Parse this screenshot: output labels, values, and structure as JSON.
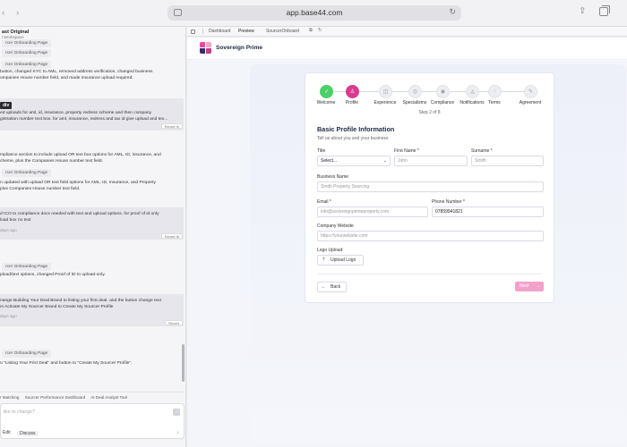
{
  "browser": {
    "url": "app.base44.com",
    "back_glyph": "‹",
    "forward_glyph": "›",
    "reload_glyph": "↻",
    "share_glyph": "⇪"
  },
  "chat": {
    "project_title": "ast Original",
    "project_subtitle": "l Workspace",
    "tags": [
      "rcer Onboarding Page",
      "rcer Onboarding Page",
      "rcer Onboarding Page",
      "rcer Onboarding Page",
      "rcer Onboarding Page"
    ],
    "dark_tag": "div",
    "messages": [
      "button, changed KYC to AML, removed address verification, changed business\nompanies House number field, and made insurance upload required.",
      "ed uploads for aml, id, insurance, property redress scheme and then company\ngistration number text box. for aml, insurance, redress and tax id give upload and tex...",
      "mpliance section to include upload OR text box options for AML, ID, insurance, and\ncheme, plus the Companies House number text field.",
      "n updated with upload OR text field options for AML, ID, Insurance, and Property\nplus Companies House number text field.",
      "d ICO to compliance docs needed with text and upload options. for proof of id only\nload box no text",
      "pload/text options, changed Proof of ID to upload-only.",
      "nange Building Your Deal Brand to listing your first deal. and the button change text\nm Activate My Sourcer Brand to Create My Sourcer Profile",
      "o \"Listing Your First Deal\" and button to \"Create My Sourcer Profile\"."
    ],
    "revert_label": "Revert",
    "revert_label_tail": "Revert th",
    "times": [
      "days ago",
      "days ago"
    ],
    "suggestions": [
      "r Matching",
      "Sourcer Performance Dashboard",
      "AI Deal Analyst Tool"
    ],
    "input_placeholder": "like to change?",
    "edit_label": "Edit",
    "discuss_label": "Discuss"
  },
  "toolbar": {
    "tabs": [
      "Dashboard",
      "Preview",
      "SourcerOnboard"
    ],
    "active_tab": "Preview",
    "link_glyph": "⧉",
    "refresh_glyph": "↻"
  },
  "app": {
    "brand": "Sovereign Prime"
  },
  "steps": {
    "items": [
      {
        "label": "Welcome",
        "state": "done",
        "glyph": "✓"
      },
      {
        "label": "Profile",
        "state": "current",
        "glyph": "♙"
      },
      {
        "label": "Experience",
        "state": "todo",
        "glyph": "◫"
      },
      {
        "label": "Specialisms",
        "state": "todo",
        "glyph": "◎"
      },
      {
        "label": "Compliance",
        "state": "todo",
        "glyph": "◉"
      },
      {
        "label": "Notifications",
        "state": "todo",
        "glyph": "◬"
      },
      {
        "label": "Terms",
        "state": "todo",
        "glyph": "◌"
      },
      {
        "label": "Agreement",
        "state": "todo",
        "glyph": "✎"
      }
    ],
    "counter": "Step 2 of 8"
  },
  "form": {
    "title": "Basic Profile Information",
    "subtitle": "Tell us about you and your business",
    "title_label": "Title",
    "title_value": "Select...",
    "first_name_label": "First Name *",
    "first_name_placeholder": "John",
    "surname_label": "Surname *",
    "surname_placeholder": "Smith",
    "business_name_label": "Business Name",
    "business_name_placeholder": "Smith Property Sourcing",
    "email_label": "Email *",
    "email_value": "info@sovereignprimeproperty.com",
    "phone_label": "Phone Number *",
    "phone_value": "07859941821",
    "website_label": "Company Website",
    "website_placeholder": "https://yourwebsite.com",
    "logo_label": "Logo Upload",
    "upload_button": "Upload Logo",
    "back_button": "Back",
    "next_button": "Next"
  }
}
